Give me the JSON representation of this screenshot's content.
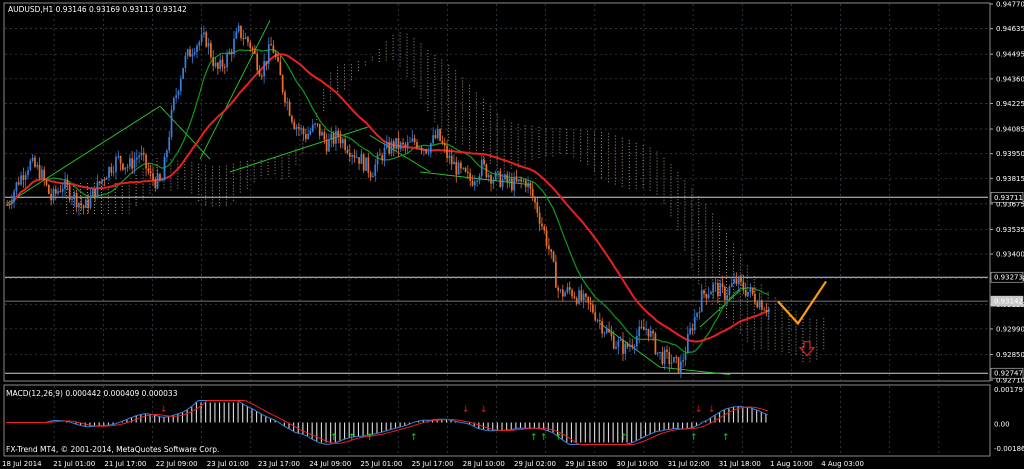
{
  "window": {
    "symbol_line": "AUDUSD,H1  0.93146 0.93169 0.93113 0.93142",
    "macd_line": "MACD(12,26,9) 0.000442 0.000409 0.000033",
    "copyright": "FX-Trend MT4, © 2001-2014, MetaQuotes Software Corp."
  },
  "price_axis": {
    "ticks": [
      "0.94770",
      "0.94635",
      "0.94495",
      "0.94360",
      "0.94225",
      "0.94085",
      "0.93950",
      "0.93815",
      "0.93675",
      "0.93535",
      "0.93400",
      "0.93265",
      "0.93125",
      "0.92990",
      "0.92850",
      "0.92710"
    ],
    "highlights": [
      {
        "value": "0.93711",
        "kind": "level"
      },
      {
        "value": "0.93273",
        "kind": "level"
      },
      {
        "value": "0.93142",
        "kind": "current"
      },
      {
        "value": "0.92747",
        "kind": "level"
      }
    ]
  },
  "macd_axis": {
    "ticks": [
      "0.001797",
      "0.00",
      "-0.001860"
    ]
  },
  "time_axis": {
    "ticks": [
      "18 Jul 2014",
      "21 Jul 01:00",
      "21 Jul 17:00",
      "22 Jul 09:00",
      "23 Jul 01:00",
      "23 Jul 17:00",
      "24 Jul 09:00",
      "25 Jul 01:00",
      "25 Jul 17:00",
      "28 Jul 10:00",
      "29 Jul 02:00",
      "29 Jul 18:00",
      "30 Jul 10:00",
      "31 Jul 02:00",
      "31 Jul 18:00",
      "1 Aug 10:00",
      "4 Aug 03:00"
    ]
  },
  "colors": {
    "background": "#000000",
    "grid": "#3a4a5a",
    "candle_up": "#3a7fd8",
    "candle_down": "#e8702a",
    "ma_slow": "#e82020",
    "ma_fast": "#0f9a1a",
    "trend_lines": "#2ecc2e",
    "cloud": "#e8d2b8",
    "projection": "#ff9a10",
    "sell_arrow": "#e02020",
    "buy_arrow": "#1fd01f"
  },
  "chart_data": {
    "type": "candlestick",
    "price_range": [
      0.9271,
      0.9477
    ],
    "current_price": 0.93142,
    "horizontal_levels": [
      0.93711,
      0.93273,
      0.92747
    ],
    "close_path": [
      0.9367,
      0.938,
      0.939,
      0.9385,
      0.937,
      0.9378,
      0.9372,
      0.9365,
      0.9375,
      0.9385,
      0.9392,
      0.9388,
      0.9395,
      0.9382,
      0.9378,
      0.942,
      0.9445,
      0.9455,
      0.9458,
      0.944,
      0.9448,
      0.9462,
      0.9455,
      0.944,
      0.9455,
      0.943,
      0.9412,
      0.9405,
      0.941,
      0.94,
      0.9405,
      0.9398,
      0.9392,
      0.9385,
      0.9395,
      0.94,
      0.9398,
      0.9402,
      0.9398,
      0.9405,
      0.9392,
      0.9385,
      0.938,
      0.9388,
      0.9382,
      0.938,
      0.9378,
      0.938,
      0.9365,
      0.9345,
      0.9318,
      0.932,
      0.9315,
      0.931,
      0.93,
      0.9292,
      0.9288,
      0.9295,
      0.93,
      0.9285,
      0.9282,
      0.9278,
      0.93,
      0.9318,
      0.9322,
      0.9318,
      0.9325,
      0.932,
      0.9315,
      0.931
    ],
    "projection": [
      0.9314,
      0.9302,
      0.9325
    ],
    "macd_range": [
      -0.00186,
      0.001797
    ]
  }
}
